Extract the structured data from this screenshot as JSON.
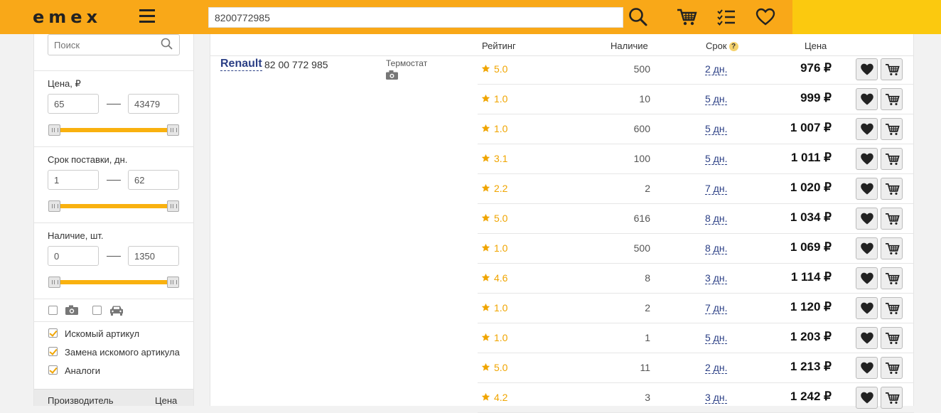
{
  "header": {
    "logo": "emex",
    "search_value": "8200772985"
  },
  "sidebar": {
    "search_placeholder": "Поиск",
    "price": {
      "label": "Цена, ₽",
      "min": "65",
      "max": "43479"
    },
    "term": {
      "label": "Срок поставки, дн.",
      "min": "1",
      "max": "62"
    },
    "stock": {
      "label": "Наличие, шт.",
      "min": "0",
      "max": "1350"
    },
    "checks": [
      {
        "label": "Искомый артикул",
        "checked": true
      },
      {
        "label": "Замена искомого артикула",
        "checked": true
      },
      {
        "label": "Аналоги",
        "checked": true
      }
    ],
    "footer": {
      "col1": "Производитель",
      "col2": "Цена"
    }
  },
  "table": {
    "headers": {
      "rating": "Рейтинг",
      "stock": "Наличие",
      "term": "Срок",
      "term_help": "?",
      "price": "Цена"
    },
    "brand": "Renault",
    "article": "82 00 772 985",
    "description": "Термостат",
    "rows": [
      {
        "rating": "5.0",
        "stock": "500",
        "term": "2 дн.",
        "price": "976 ₽"
      },
      {
        "rating": "1.0",
        "stock": "10",
        "term": "5 дн.",
        "price": "999 ₽"
      },
      {
        "rating": "1.0",
        "stock": "600",
        "term": "5 дн.",
        "price": "1 007 ₽"
      },
      {
        "rating": "3.1",
        "stock": "100",
        "term": "5 дн.",
        "price": "1 011 ₽"
      },
      {
        "rating": "2.2",
        "stock": "2",
        "term": "7 дн.",
        "price": "1 020 ₽"
      },
      {
        "rating": "5.0",
        "stock": "616",
        "term": "8 дн.",
        "price": "1 034 ₽"
      },
      {
        "rating": "1.0",
        "stock": "500",
        "term": "8 дн.",
        "price": "1 069 ₽"
      },
      {
        "rating": "4.6",
        "stock": "8",
        "term": "3 дн.",
        "price": "1 114 ₽"
      },
      {
        "rating": "1.0",
        "stock": "2",
        "term": "7 дн.",
        "price": "1 120 ₽"
      },
      {
        "rating": "1.0",
        "stock": "1",
        "term": "5 дн.",
        "price": "1 203 ₽"
      },
      {
        "rating": "5.0",
        "stock": "11",
        "term": "2 дн.",
        "price": "1 213 ₽"
      },
      {
        "rating": "4.2",
        "stock": "3",
        "term": "3 дн.",
        "price": "1 242 ₽"
      }
    ]
  },
  "colors": {
    "header": "#f9a818",
    "accent": "#fbc90f",
    "link": "#2b3f85",
    "star": "#f0a500"
  }
}
